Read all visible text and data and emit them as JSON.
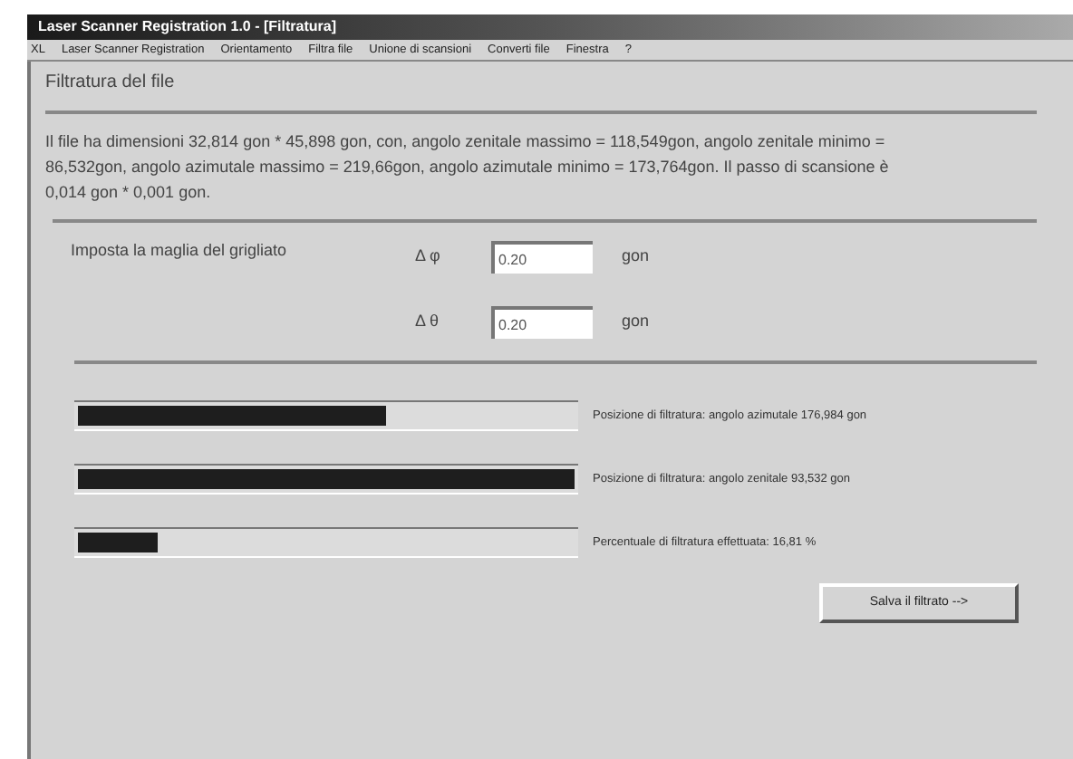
{
  "window": {
    "title": "Laser Scanner Registration 1.0 - [Filtratura]"
  },
  "menu": [
    {
      "label": "XL"
    },
    {
      "label": "Laser Scanner Registration"
    },
    {
      "label": "Orientamento"
    },
    {
      "label": "Filtra file"
    },
    {
      "label": "Unione di scansioni"
    },
    {
      "label": "Converti file"
    },
    {
      "label": "Finestra"
    },
    {
      "label": "?"
    }
  ],
  "heading": "Filtratura del file",
  "description": "Il file ha dimensioni 32,814 gon * 45,898 gon, con, angolo zenitale massimo = 118,549gon, angolo zenitale minimo = 86,532gon, angolo azimutale massimo = 219,66gon, angolo azimutale minimo = 173,764gon. Il passo di scansione è 0,014 gon * 0,001 gon.",
  "grid": {
    "label": "Imposta la maglia del grigliato",
    "fields": [
      {
        "symbol": "Δ φ",
        "value": "0.20",
        "unit": "gon"
      },
      {
        "symbol": "Δ θ",
        "value": "0.20",
        "unit": "gon"
      }
    ]
  },
  "progress": [
    {
      "level": 0.62,
      "label": "Posizione di filtratura: angolo azimutale 176,984 gon"
    },
    {
      "level": 1.0,
      "label": "Posizione di filtratura: angolo zenitale 93,532 gon"
    },
    {
      "level": 0.16,
      "label": "Percentuale di filtratura effettuata: 16,81 %"
    }
  ],
  "button": "Salva il filtrato -->"
}
